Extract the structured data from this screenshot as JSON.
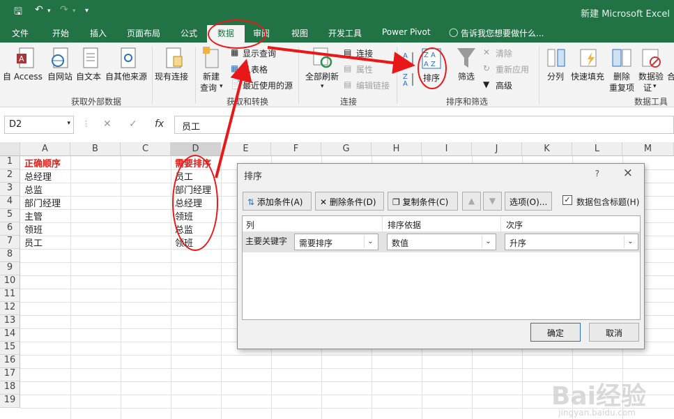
{
  "title_bar": {
    "title": "新建 Microsoft Excel"
  },
  "tabs": [
    "文件",
    "开始",
    "插入",
    "页面布局",
    "公式",
    "数据",
    "审阅",
    "视图",
    "开发工具",
    "Power Pivot"
  ],
  "active_tab": "数据",
  "tell_me": "告诉我您想要做什么...",
  "ribbon": {
    "get_external": {
      "label": "获取外部数据",
      "items": [
        "自 Access",
        "自网站",
        "自文本",
        "自其他来源"
      ]
    },
    "existing_conn": "现有连接",
    "get_transform": {
      "label": "获取和转换",
      "new_query": "新建",
      "new_query2": "查询",
      "show_query": "显示查询",
      "from_table": "从表格",
      "recent": "最近使用的源"
    },
    "connections": {
      "label": "连接",
      "refresh": "全部刷新",
      "conn": "连接",
      "props": "属性",
      "edit_links": "编辑链接"
    },
    "sort_filter": {
      "label": "排序和筛选",
      "sort": "排序",
      "filter": "筛选",
      "clear": "清除",
      "reapply": "重新应用",
      "advanced": "高级"
    },
    "data_tools": {
      "label": "数据工具",
      "split": "分列",
      "flash_fill": "快速填充",
      "remove_dup": "删除",
      "remove_dup2": "重复项",
      "validate": "数据验",
      "validate2": "证",
      "consolidate": "合"
    }
  },
  "formula_bar": {
    "name_box": "D2",
    "fx": "fx",
    "value": "员工"
  },
  "columns": [
    "A",
    "B",
    "C",
    "D",
    "E",
    "F",
    "G",
    "H",
    "I",
    "J",
    "K",
    "L",
    "M"
  ],
  "rows": [
    "1",
    "2",
    "3",
    "4",
    "5",
    "6",
    "7",
    "8",
    "9",
    "10",
    "11",
    "12",
    "13",
    "14",
    "15",
    "16",
    "17",
    "18",
    "19"
  ],
  "col_a": [
    "正确顺序",
    "总经理",
    "总监",
    "部门经理",
    "主管",
    "领班",
    "员工"
  ],
  "col_d": [
    "需要排序",
    "员工",
    "部门经理",
    "总经理",
    "领班",
    "总监",
    "领班"
  ],
  "dialog": {
    "title": "排序",
    "help": "?",
    "close": "×",
    "add": "添加条件(A)",
    "delete": "删除条件(D)",
    "copy": "复制条件(C)",
    "options": "选项(O)...",
    "has_header": "数据包含标题(H)",
    "col_header": "列",
    "sort_on_header": "排序依据",
    "order_header": "次序",
    "primary_key": "主要关键字",
    "col_value": "需要排序",
    "sort_on_value": "数值",
    "order_value": "升序",
    "ok": "确定",
    "cancel": "取消"
  },
  "watermark": {
    "brand": "Bai经验",
    "url": "jingyan.baidu.com"
  },
  "colors": {
    "excel_green": "#217346",
    "annotation_red": "#e81818",
    "header_red": "#e0201a"
  }
}
